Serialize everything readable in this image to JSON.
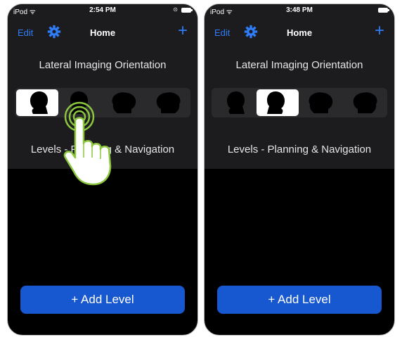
{
  "screens": [
    {
      "status": {
        "carrier": "iPod ᯤ",
        "time": "2:54 PM",
        "misc": "⊙"
      },
      "nav": {
        "edit": "Edit",
        "title": "Home",
        "add": "+"
      },
      "section_title": "Lateral Imaging Orientation",
      "selected_option": 1,
      "orientation_options": [
        "head-right-facing",
        "head-right-back",
        "head-left-facing",
        "head-left-back"
      ],
      "levels_label": "Levels - Planning & Navigation",
      "add_button": "+ Add Level",
      "tap_gesture_on_option": 2
    },
    {
      "status": {
        "carrier": "iPod ᯤ",
        "time": "3:48 PM",
        "misc": ""
      },
      "nav": {
        "edit": "Edit",
        "title": "Home",
        "add": "+"
      },
      "section_title": "Lateral Imaging Orientation",
      "selected_option": 2,
      "orientation_options": [
        "head-right-facing",
        "head-right-back",
        "head-left-facing",
        "head-left-back"
      ],
      "levels_label": "Levels - Planning & Navigation",
      "add_button": "+ Add Level"
    }
  ],
  "colors": {
    "accent": "#2f7cf6",
    "button": "#1758d0",
    "hand_outline": "#8cc63f"
  },
  "icons": {
    "gear": "gear-icon",
    "hand": "tap-hand-icon"
  }
}
